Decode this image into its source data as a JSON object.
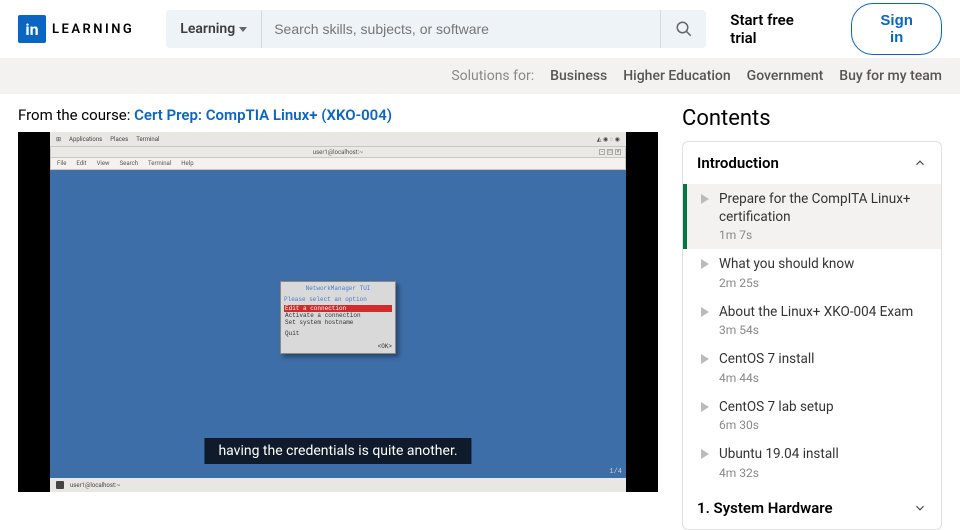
{
  "logo": {
    "box": "in",
    "text": "LEARNING"
  },
  "search": {
    "scope": "Learning",
    "placeholder": "Search skills, subjects, or software"
  },
  "cta": {
    "trial": "Start free trial",
    "signin": "Sign in"
  },
  "subnav": {
    "label": "Solutions for:",
    "items": [
      "Business",
      "Higher Education",
      "Government",
      "Buy for my team"
    ]
  },
  "course": {
    "from_label": "From the course: ",
    "title": "Cert Prep: CompTIA Linux+ (XKO-004)"
  },
  "video": {
    "caption": "having the credentials is quite another.",
    "slide": "1/4",
    "desktop": {
      "menu": [
        "Applications",
        "Places",
        "Terminal"
      ],
      "window_title": "user1@localhost:~",
      "bottom_bar": "user1@localhost:~",
      "term_menu": [
        "File",
        "Edit",
        "View",
        "Search",
        "Terminal",
        "Help"
      ],
      "dialog": {
        "title": "NetworkManager TUI",
        "prompt": "Please select an option",
        "options": [
          "Edit a connection",
          "Activate a connection",
          "Set system hostname"
        ],
        "quit": "Quit",
        "ok": "<OK>"
      }
    }
  },
  "contents": {
    "heading": "Contents",
    "sections": [
      {
        "title": "Introduction",
        "open": true,
        "items": [
          {
            "title": "Prepare for the CompITA Linux+ certification",
            "time": "1m 7s",
            "active": true
          },
          {
            "title": "What you should know",
            "time": "2m 25s"
          },
          {
            "title": "About the Linux+ XKO-004 Exam",
            "time": "3m 54s"
          },
          {
            "title": "CentOS 7 install",
            "time": "4m 44s"
          },
          {
            "title": "CentOS 7 lab setup",
            "time": "6m 30s"
          },
          {
            "title": "Ubuntu 19.04 install",
            "time": "4m 32s"
          }
        ]
      },
      {
        "title": "1. System Hardware",
        "open": false,
        "items": []
      }
    ]
  }
}
